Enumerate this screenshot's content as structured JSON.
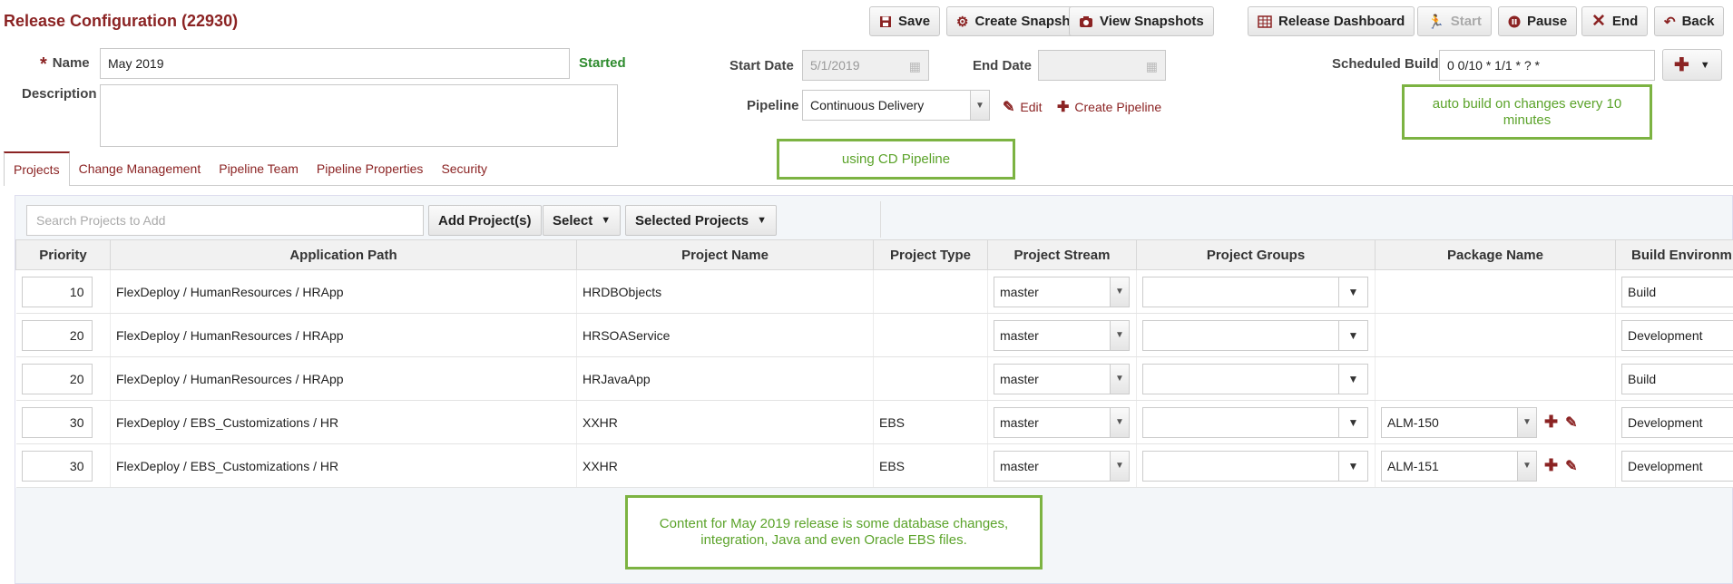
{
  "page": {
    "title": "Release Configuration (22930)"
  },
  "toolbar": {
    "save": "Save",
    "create_snapshot": "Create Snapshot",
    "view_snapshots": "View Snapshots",
    "release_dashboard": "Release Dashboard",
    "start": "Start",
    "pause": "Pause",
    "end": "End",
    "back": "Back"
  },
  "form": {
    "name_label": "Name",
    "name_value": "May 2019",
    "status": "Started",
    "description_label": "Description",
    "description_value": "",
    "start_date_label": "Start Date",
    "start_date_value": "5/1/2019",
    "end_date_label": "End Date",
    "end_date_value": "",
    "pipeline_label": "Pipeline",
    "pipeline_value": "Continuous Delivery",
    "edit_link": "Edit",
    "create_pipeline_link": "Create Pipeline",
    "scheduled_build_label": "Scheduled Build",
    "scheduled_build_value": "0 0/10 * 1/1 * ? *"
  },
  "notes": {
    "auto_build": "auto build on changes every 10 minutes",
    "cd_pipeline": "using CD Pipeline",
    "content": "Content for May 2019 release is some database changes, integration, Java and even Oracle EBS files."
  },
  "tabs": [
    {
      "label": "Projects",
      "active": true
    },
    {
      "label": "Change Management",
      "active": false
    },
    {
      "label": "Pipeline Team",
      "active": false
    },
    {
      "label": "Pipeline Properties",
      "active": false
    },
    {
      "label": "Security",
      "active": false
    }
  ],
  "projects_toolbar": {
    "search_placeholder": "Search Projects to Add",
    "add_projects": "Add Project(s)",
    "select": "Select",
    "selected_projects": "Selected Projects"
  },
  "table": {
    "columns": [
      "Priority",
      "Application Path",
      "Project Name",
      "Project Type",
      "Project Stream",
      "Project Groups",
      "Package Name",
      "Build Environm"
    ],
    "rows": [
      {
        "priority": "10",
        "path": "FlexDeploy / HumanResources / HRApp",
        "name": "HRDBObjects",
        "type": "",
        "stream": "master",
        "groups": "",
        "package": "",
        "env": "Build"
      },
      {
        "priority": "20",
        "path": "FlexDeploy / HumanResources / HRApp",
        "name": "HRSOAService",
        "type": "",
        "stream": "master",
        "groups": "",
        "package": "",
        "env": "Development"
      },
      {
        "priority": "20",
        "path": "FlexDeploy / HumanResources / HRApp",
        "name": "HRJavaApp",
        "type": "",
        "stream": "master",
        "groups": "",
        "package": "",
        "env": "Build"
      },
      {
        "priority": "30",
        "path": "FlexDeploy / EBS_Customizations / HR",
        "name": "XXHR",
        "type": "EBS",
        "stream": "master",
        "groups": "",
        "package": "ALM-150",
        "env": "Development"
      },
      {
        "priority": "30",
        "path": "FlexDeploy / EBS_Customizations / HR",
        "name": "XXHR",
        "type": "EBS",
        "stream": "master",
        "groups": "",
        "package": "ALM-151",
        "env": "Development"
      }
    ]
  },
  "colors": {
    "brand": "#8b2323",
    "status_green": "#2e8b2e",
    "note_border": "#7cb342"
  }
}
